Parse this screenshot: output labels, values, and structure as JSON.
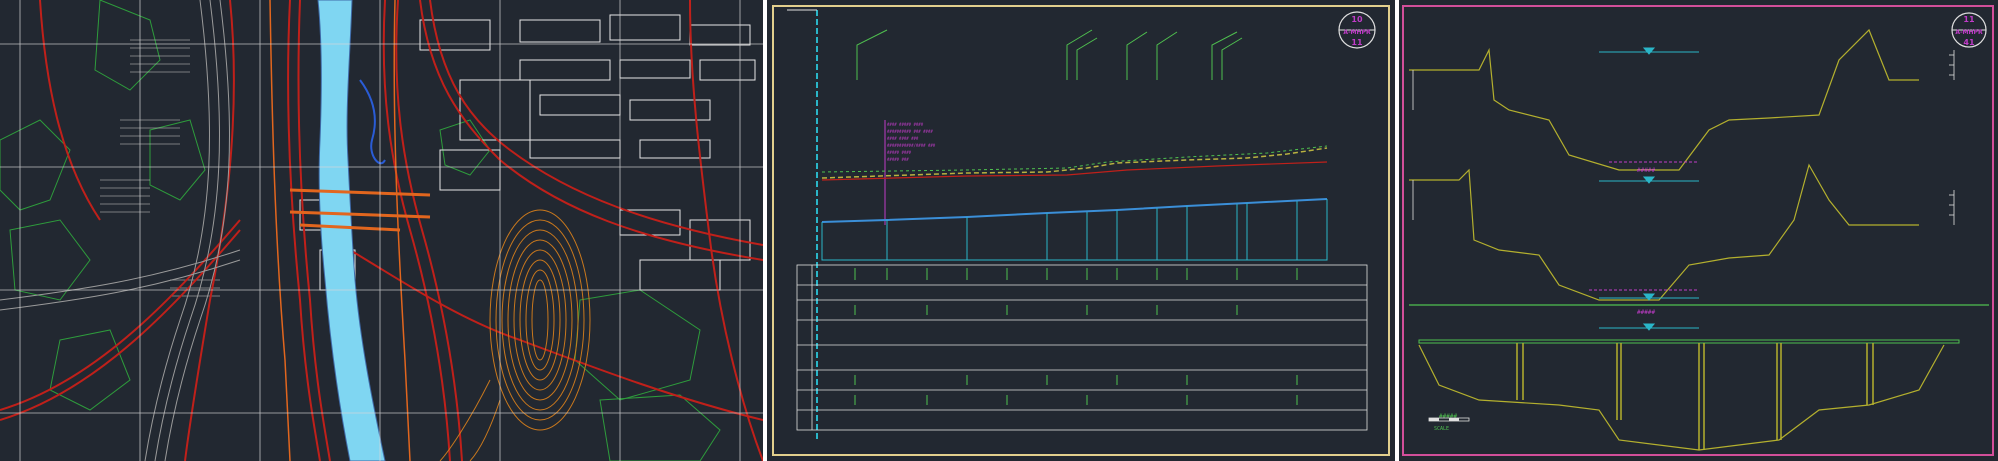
{
  "panels": {
    "plan": {
      "title": ""
    },
    "profile": {
      "sheet_no": "10",
      "sheet_code": "A-MHPR",
      "sheet_total": "11",
      "note_lines": [
        "#### ##### ####",
        "########## ### ####",
        "#### #### ###",
        "###########/#### ###",
        "##### ####",
        "##### ###"
      ]
    },
    "sections": {
      "sheet_no": "11",
      "sheet_code": "A-MHPR",
      "sheet_total": "41",
      "label_top": "#####",
      "label_mid": "#####",
      "label_bot": "#####",
      "scale_label": "SCALE"
    }
  },
  "colors": {
    "background": "#222831",
    "river": "#7fd6f2",
    "road_red": "#c0201a",
    "orange_hatch": "#e2661e",
    "contour_orange": "#c9781d",
    "vegetation_green": "#2e9c3c",
    "grid_white": "#d9d9d9",
    "profile_yellow": "#b9b240",
    "profile_green": "#4fc04f",
    "profile_blue": "#3b8fd8",
    "profile_cyan": "#2ab6c8",
    "section_yellow": "#b4b02e",
    "section_magenta": "#c03cc8",
    "sheet_border_yellow": "#e2cf8d",
    "sheet_border_pink": "#d24f9a"
  }
}
